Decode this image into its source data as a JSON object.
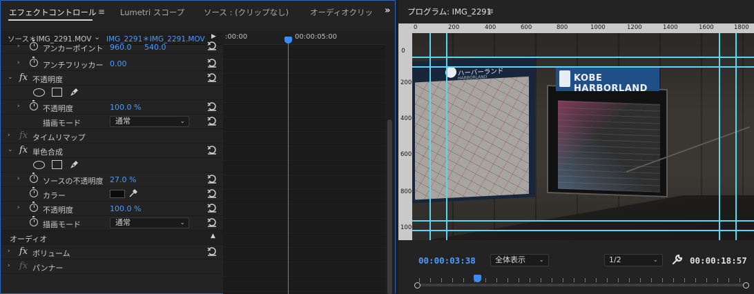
{
  "left_panel": {
    "tabs": [
      {
        "label": "エフェクトコントロール"
      },
      {
        "label": "Lumetri スコープ"
      },
      {
        "label": "ソース : (クリップなし)"
      },
      {
        "label": "オーディオクリッ"
      }
    ],
    "menu_glyph": "≡",
    "overflow_glyph": "»",
    "source_header": {
      "master_clip": "ソース＊IMG_2291.MOV",
      "caret": "⌄",
      "sequence_clip": "IMG_2291＊IMG_2291.MOV",
      "play": "▶"
    },
    "controls": {
      "anchor": {
        "label": "アンカーポイント",
        "x": "960.0",
        "y": "540.0"
      },
      "anti_flicker": {
        "label": "アンチフリッカー",
        "value": "0.00"
      },
      "opacity_group": {
        "label": "不透明度"
      },
      "opacity": {
        "label": "不透明度",
        "value": "100.0 %"
      },
      "blend_mode": {
        "label": "描画モード",
        "value": "通常"
      },
      "time_remap": {
        "label": "タイムリマップ"
      },
      "single_color": {
        "label": "単色合成"
      },
      "source_opacity": {
        "label": "ソースの不透明度",
        "value": "27.0 %"
      },
      "color": {
        "label": "カラー",
        "swatch": "#0a0a0a"
      },
      "sc_opacity": {
        "label": "不透明度",
        "value": "100.0 %"
      },
      "sc_blend": {
        "label": "描画モード",
        "value": "通常"
      },
      "audio_section": {
        "label": "オーディオ"
      },
      "volume": {
        "label": "ボリューム"
      },
      "panner": {
        "label": "パンナー"
      }
    },
    "timeline": {
      "start": ":00:00",
      "marker": "00:00:05:00"
    }
  },
  "right_panel": {
    "title": "プログラム: IMG_2291",
    "menu_glyph": "≡",
    "ruler_top": [
      "0",
      "200",
      "400",
      "600",
      "800",
      "1000",
      "1200",
      "1400",
      "1600",
      "1800"
    ],
    "ruler_left": [
      "0",
      "200",
      "400",
      "600",
      "800",
      "1000"
    ],
    "video": {
      "map_left_title": "ハーバーランド",
      "map_left_sub": "HARBORLAND",
      "sign_right": "KOBE HARBORLAND"
    },
    "transport": {
      "current_time": "00:00:03:38",
      "zoom_label": "全体表示",
      "resolution_label": "1/2",
      "total_time": "00:00:18:57"
    }
  },
  "colors": {
    "accent_blue": "#4c9cff",
    "guide_cyan": "#59d8f0",
    "panel_bg": "#232323"
  }
}
